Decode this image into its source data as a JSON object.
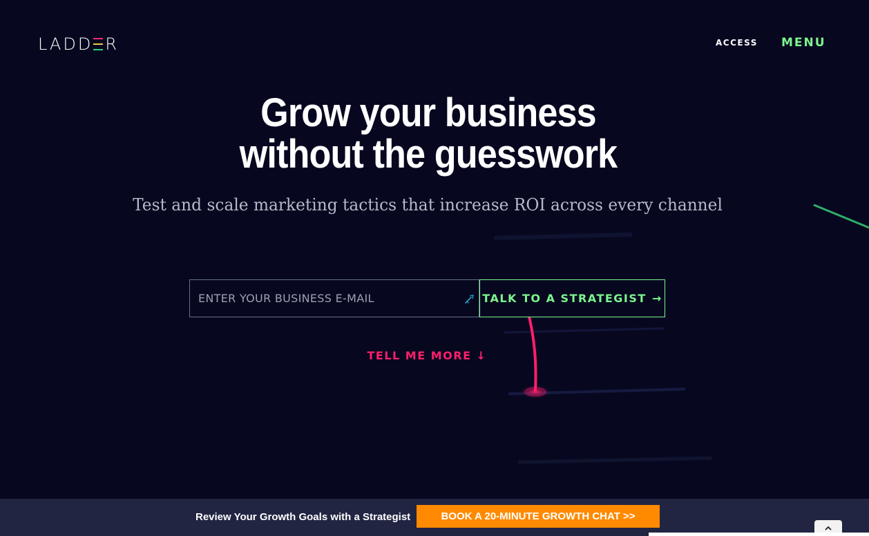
{
  "brand": {
    "logo_pre": "LADD",
    "logo_post": "R"
  },
  "nav": {
    "access": "ACCESS",
    "menu": "MENU"
  },
  "hero": {
    "headline_line1": "Grow your business",
    "headline_line2": "without the guesswork",
    "subheadline": "Test and scale marketing tactics that increase ROI across every channel"
  },
  "form": {
    "email_placeholder": "ENTER YOUR BUSINESS E-MAIL",
    "cta_label": "TALK TO A STRATEGIST",
    "cta_arrow": "→"
  },
  "tell_more": {
    "label": "TELL ME MORE",
    "arrow": "↓"
  },
  "footer_bar": {
    "text": "Review Your Growth Goals with a Strategist",
    "button": "BOOK A 20-MINUTE GROWTH CHAT >>"
  },
  "icons": [
    "autofill-key-icon",
    "chevron-up-icon",
    "right-arrow-icon",
    "down-arrow-icon"
  ],
  "colors": {
    "background": "#070820",
    "accent_green": "#7cf58c",
    "accent_pink": "#ff1f6b",
    "cta_orange": "#ff8a00",
    "bottom_bar": "#212542"
  }
}
